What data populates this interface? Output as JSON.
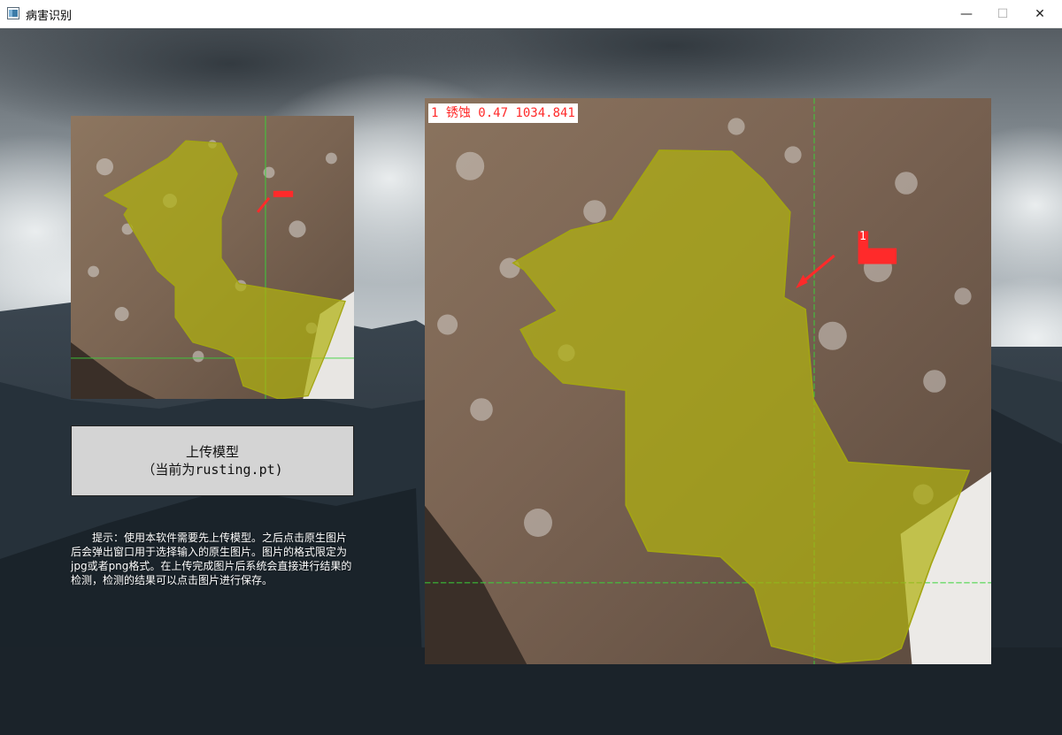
{
  "window": {
    "title": "病害识别",
    "minimize_glyph": "—",
    "maximize_glyph": "☐",
    "close_glyph": "✕"
  },
  "upload": {
    "label": "上传模型",
    "current_model": "（当前为rusting.pt)"
  },
  "hint": {
    "text": "提示：使用本软件需要先上传模型。之后点击原生图片后会弹出窗口用于选择输入的原生图片。图片的格式限定为jpg或者png格式。在上传完成图片后系统会直接进行结果的检测，检测的结果可以点击图片进行保存。"
  },
  "detection": {
    "label": "1 锈蚀 0.47 1034.841",
    "marker_text": "1",
    "mask_color": "#b0b210",
    "label_color": "#ff2a2a",
    "guide_color": "#39d339"
  },
  "icons": {
    "app": "app-window-icon"
  }
}
